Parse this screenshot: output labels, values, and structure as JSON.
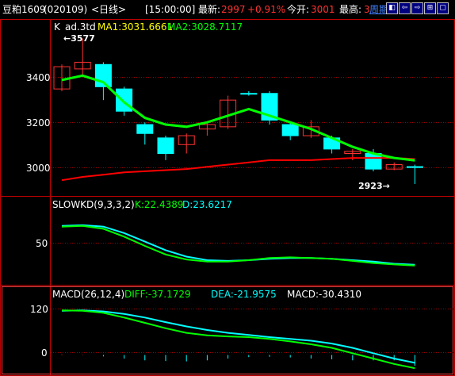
{
  "header": {
    "symbol": "豆粕1609",
    "code": "(020109)",
    "period": "<日线>",
    "time": "[15:00:00]",
    "latest_label": "最新:",
    "latest_value": "2997",
    "change": "+0.91%",
    "open_label": "今开:",
    "open_value": "3001",
    "high_label": "最高:",
    "high_value": "3",
    "weekly_link": "周期"
  },
  "header_buttons": [
    "◧",
    "⇦",
    "⇨",
    "⊞",
    "▢"
  ],
  "colors": {
    "bg": "#000000",
    "up": "#ff3232",
    "down": "#00ffff",
    "ma1": "#ffff00",
    "ma2": "#00ff00",
    "grid": "#c00000"
  },
  "main_panel": {
    "label_k": "K",
    "indicator_name": "ad.3td",
    "ma1_label": "MA1:3031.6661",
    "ma2_label": "MA2:3028.7117",
    "high_annotation": "←3577",
    "low_annotation": "2923→",
    "y_ticks": [
      "3400",
      "3200",
      "3000"
    ]
  },
  "kd_panel": {
    "label": "SLOWKD(9,3,3,2)",
    "k_label": "K:22.4389",
    "d_label": "D:23.6217",
    "y_ticks": [
      "50"
    ]
  },
  "macd_panel": {
    "label": "MACD(26,12,4)",
    "diff_label": "DIFF:-37.1729",
    "dea_label": "DEA:-21.9575",
    "macd_label": "MACD:-30.4310",
    "y_ticks": [
      "120",
      "0"
    ]
  },
  "chart_data": {
    "type": "candlestick",
    "candles": [
      {
        "o": 3350,
        "h": 3460,
        "l": 3340,
        "c": 3450,
        "up": true
      },
      {
        "o": 3440,
        "h": 3577,
        "l": 3410,
        "c": 3470,
        "up": true
      },
      {
        "o": 3460,
        "h": 3470,
        "l": 3300,
        "c": 3360,
        "up": false
      },
      {
        "o": 3350,
        "h": 3360,
        "l": 3230,
        "c": 3250,
        "up": false
      },
      {
        "o": 3190,
        "h": 3200,
        "l": 3100,
        "c": 3150,
        "up": false
      },
      {
        "o": 3130,
        "h": 3140,
        "l": 3030,
        "c": 3060,
        "up": false
      },
      {
        "o": 3100,
        "h": 3150,
        "l": 3060,
        "c": 3140,
        "up": true
      },
      {
        "o": 3170,
        "h": 3200,
        "l": 3140,
        "c": 3190,
        "up": true
      },
      {
        "o": 3180,
        "h": 3320,
        "l": 3170,
        "c": 3300,
        "up": true
      },
      {
        "o": 3330,
        "h": 3340,
        "l": 3320,
        "c": 3330,
        "up": false
      },
      {
        "o": 3330,
        "h": 3340,
        "l": 3190,
        "c": 3210,
        "up": false
      },
      {
        "o": 3190,
        "h": 3200,
        "l": 3120,
        "c": 3140,
        "up": false
      },
      {
        "o": 3140,
        "h": 3210,
        "l": 3130,
        "c": 3180,
        "up": true
      },
      {
        "o": 3130,
        "h": 3140,
        "l": 3060,
        "c": 3080,
        "up": false
      },
      {
        "o": 3060,
        "h": 3080,
        "l": 3030,
        "c": 3070,
        "up": true
      },
      {
        "o": 3060,
        "h": 3080,
        "l": 2980,
        "c": 2990,
        "up": false
      },
      {
        "o": 2990,
        "h": 3020,
        "l": 2985,
        "c": 3010,
        "up": true
      },
      {
        "o": 3001,
        "h": 3010,
        "l": 2923,
        "c": 2997,
        "up": false
      }
    ],
    "ma1": [
      3390,
      3420,
      3390,
      3300,
      3220,
      3190,
      3180,
      3200,
      3240,
      3260,
      3240,
      3200,
      3170,
      3140,
      3100,
      3070,
      3050,
      3031.6661
    ],
    "ma2": [
      3390,
      3410,
      3380,
      3290,
      3220,
      3190,
      3180,
      3200,
      3230,
      3260,
      3230,
      3200,
      3170,
      3130,
      3090,
      3060,
      3040,
      3028.7117
    ],
    "ma3": [
      2940,
      2955,
      2965,
      2975,
      2980,
      2985,
      2990,
      3000,
      3010,
      3020,
      3030,
      3030,
      3030,
      3035,
      3040,
      3040,
      3040,
      3035
    ],
    "kd_k": [
      77,
      78,
      74,
      63,
      50,
      38,
      31,
      28,
      28,
      30,
      33,
      34,
      33,
      32,
      29,
      26,
      24,
      22.4389
    ],
    "kd_d": [
      78,
      79,
      77,
      68,
      56,
      44,
      35,
      30,
      29,
      30,
      32,
      33,
      33,
      32,
      30,
      28,
      25,
      23.6217
    ],
    "macd_diff": [
      125,
      124,
      118,
      105,
      90,
      75,
      62,
      55,
      52,
      50,
      45,
      38,
      30,
      20,
      5,
      -10,
      -25,
      -37.1729
    ],
    "macd_dea": [
      124,
      125,
      122,
      115,
      105,
      92,
      80,
      70,
      62,
      56,
      50,
      45,
      40,
      32,
      20,
      5,
      -10,
      -21.9575
    ],
    "macd_hist": [
      2,
      1,
      -4,
      -10,
      -15,
      -17,
      -18,
      -15,
      -10,
      -6,
      -5,
      -7,
      -10,
      -12,
      -15,
      -15,
      -15,
      -30.431
    ],
    "ylim_main": [
      2880,
      3600
    ],
    "ylim_kd": [
      0,
      100
    ],
    "ylim_macd": [
      -50,
      150
    ]
  }
}
